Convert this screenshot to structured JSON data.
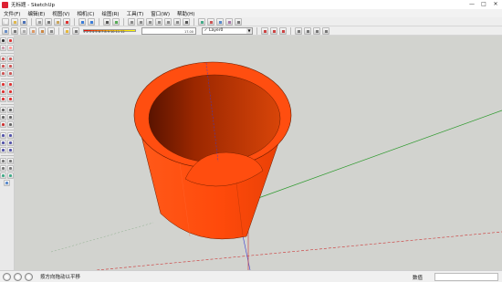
{
  "window": {
    "title": "无标题 - SketchUp",
    "minimize": "—",
    "maximize": "□",
    "close": "✕"
  },
  "menu": [
    "文件(F)",
    "编辑(E)",
    "视图(V)",
    "相机(C)",
    "绘图(R)",
    "工具(T)",
    "窗口(W)",
    "帮助(H)"
  ],
  "toolbar": {
    "fog_ticks": "1 2 3 4 5 6 7 8 9 10 11 12",
    "fog_end_value": "17.00",
    "layer_name": "Layer0",
    "layer_check": "✓",
    "layer_arrow": "▼"
  },
  "status": {
    "hint": "按方向拖动以平移",
    "measurements_label": "数值",
    "measurements_value": ""
  },
  "scene": {
    "cup_outer_color": "#ff4a0b",
    "cup_inner_color": "#c93a08",
    "background_color": "#d2d3cf",
    "axis_red": "#cc3333",
    "axis_green": "#2e9a2e",
    "axis_blue": "#3b3bd0"
  }
}
